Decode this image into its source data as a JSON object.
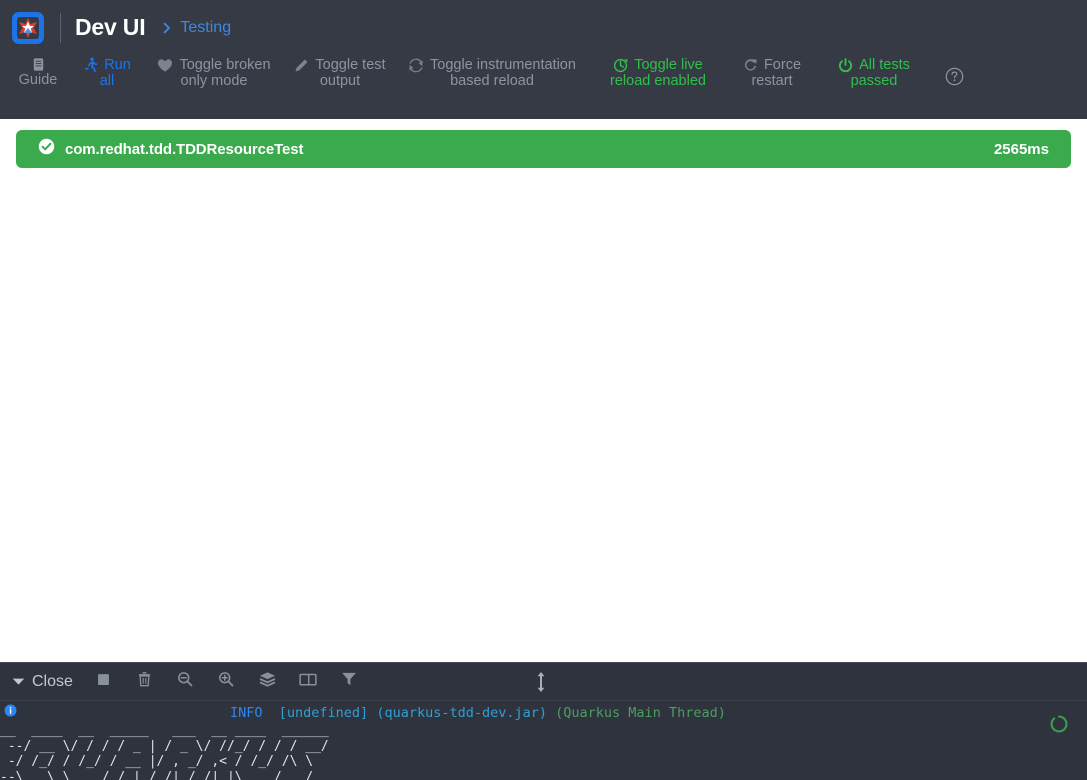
{
  "header": {
    "logo_icon": "quarkus-logo-icon",
    "brand": "Dev UI",
    "breadcrumb": {
      "chevron_icon": "chevron-right-icon",
      "label": "Testing"
    },
    "toolbar": [
      {
        "key": "guide",
        "icon": "book-icon",
        "line1": "Guide",
        "line2": "",
        "color": "#8e949f"
      },
      {
        "key": "run-all",
        "icon": "running-person-icon",
        "line1": "Run",
        "line2": "all",
        "color": "#1d74e8"
      },
      {
        "key": "broken-only",
        "icon": "heart-icon",
        "line1": "Toggle broken",
        "line2": "only mode",
        "color": "#8e949f"
      },
      {
        "key": "test-output",
        "icon": "pencil-icon",
        "line1": "Toggle test",
        "line2": "output",
        "color": "#8e949f"
      },
      {
        "key": "instrumentation",
        "icon": "refresh-icon",
        "line1": "Toggle instrumentation",
        "line2": "based reload",
        "color": "#8e949f"
      },
      {
        "key": "live-reload",
        "icon": "live-reload-icon",
        "line1": "Toggle live",
        "line2": "reload enabled",
        "color": "#2fc04a"
      },
      {
        "key": "force-restart",
        "icon": "restart-icon",
        "line1": "Force",
        "line2": "restart",
        "color": "#8e949f"
      },
      {
        "key": "all-tests",
        "icon": "power-icon",
        "line1": "All tests",
        "line2": "passed",
        "color": "#2fc04a"
      }
    ],
    "help_icon": "help-circle-icon"
  },
  "main": {
    "tests": [
      {
        "status_icon": "check-circle-icon",
        "name": "com.redhat.tdd.TDDResourceTest",
        "duration": "2565ms",
        "color": "#3aaa4c"
      }
    ]
  },
  "console": {
    "close_label": "Close",
    "close_icon": "caret-down-icon",
    "buttons": [
      {
        "key": "stop",
        "icon": "stop-square-icon"
      },
      {
        "key": "clear",
        "icon": "trash-icon"
      },
      {
        "key": "zoom-out",
        "icon": "zoom-out-icon"
      },
      {
        "key": "zoom-in",
        "icon": "zoom-in-icon"
      },
      {
        "key": "follow-log",
        "icon": "layers-icon"
      },
      {
        "key": "split-view",
        "icon": "split-panel-icon"
      },
      {
        "key": "filter",
        "icon": "filter-icon"
      }
    ],
    "resize_icon": "vertical-resize-icon",
    "spinner_icon": "loading-spinner-icon",
    "log_lines": [
      {
        "icon": "info-circle-icon",
        "level": "INFO",
        "source": "[undefined]",
        "jar": "(quarkus-tdd-dev.jar)",
        "thread": "(Quarkus Main Thread)"
      }
    ],
    "banner_ascii": "__  ____  __  _____   ___  __ ____  ______ \n --/ __ \\/ / / / _ | / _ \\/ //_/ / / / __/ \n -/ /_/ / /_/ / __ |/ , _/ ,< / /_/ /\\ \\   \n--\\___\\_\\____/_/ |_/_/|_/_/|_|\\____/___/   "
  },
  "colors": {
    "header_bg": "#353a45",
    "console_bg": "#2e333d",
    "main_bg": "#ffffff",
    "success": "#3aaa4c",
    "accent_blue": "#1d74e8",
    "accent_green": "#2fc04a",
    "muted": "#8e949f"
  }
}
